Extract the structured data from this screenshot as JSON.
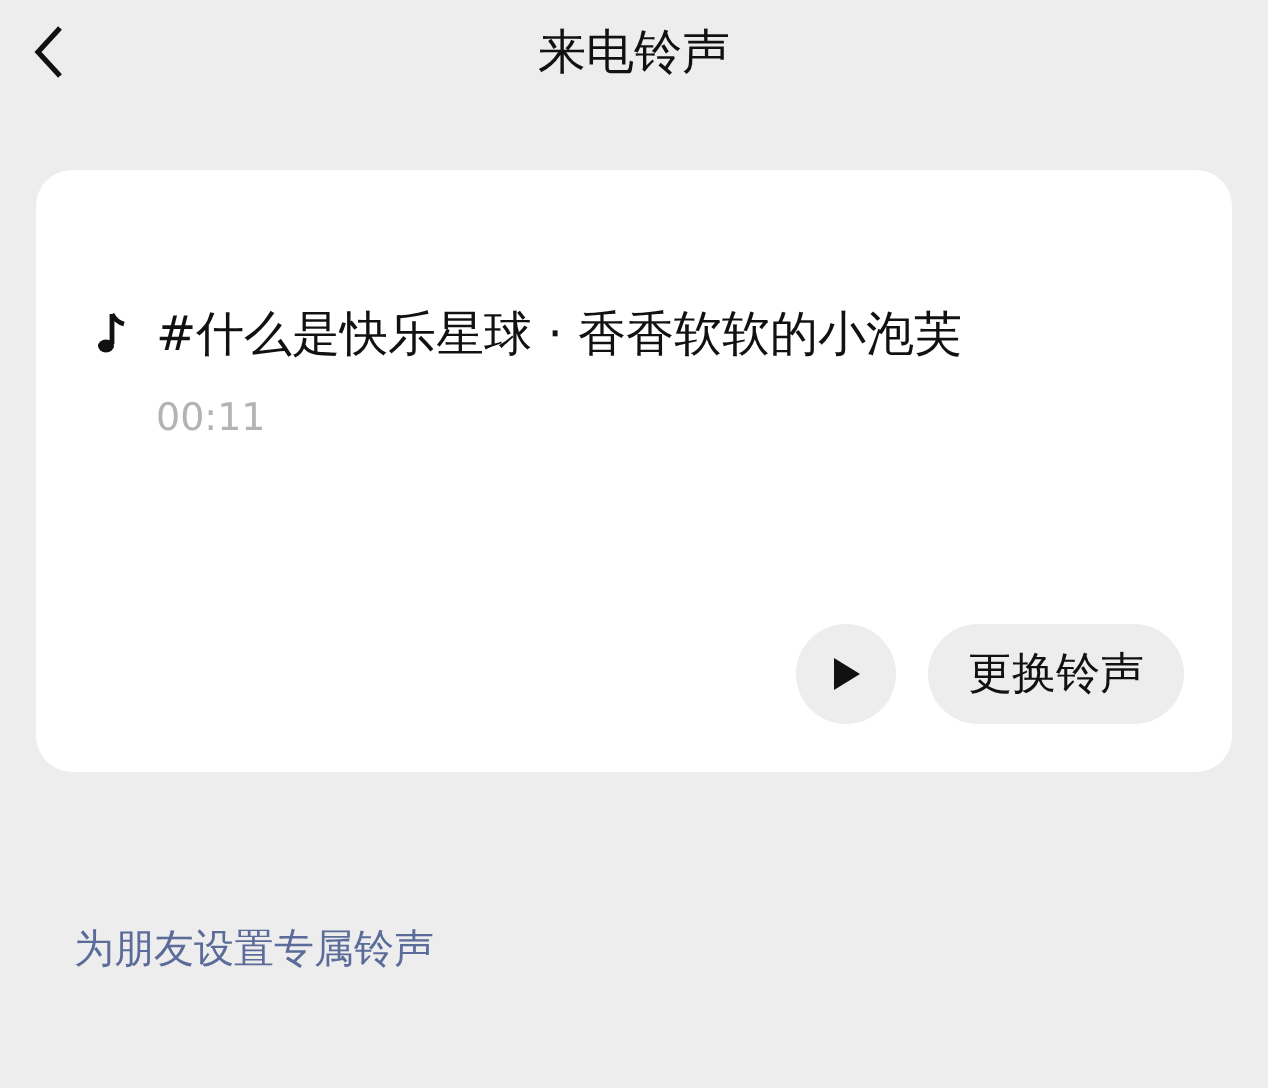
{
  "header": {
    "title": "来电铃声"
  },
  "ringtone": {
    "name": "#什么是快乐星球 · 香香软软的小泡芙",
    "duration": "00:11",
    "playing": false
  },
  "change_button": "更换铃声",
  "friend_link": "为朋友设置专属铃声"
}
